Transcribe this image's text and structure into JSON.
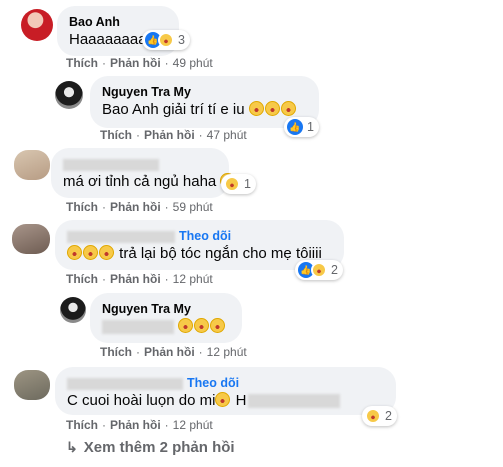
{
  "actions": {
    "like": "Thích",
    "reply": "Phản hồi",
    "sep": "·"
  },
  "comments": [
    {
      "author": "Bao Anh",
      "text": "Haaaaaaaa",
      "reactions": "3",
      "time": "49 phút"
    },
    {
      "author": "Nguyen Tra My",
      "text": "Bao Anh giải trí tí e iu",
      "reactions": "1",
      "time": "47 phút"
    },
    {
      "author": "",
      "text": "má ơi tỉnh cả ngủ haha",
      "reactions": "1",
      "time": "59 phút"
    },
    {
      "author": "",
      "follow": "Theo dõi",
      "text": "trả lại bộ tóc ngắn cho mẹ tôiiii",
      "reactions": "2",
      "time": "12 phút"
    },
    {
      "author": "Nguyen Tra My",
      "text": "",
      "time": "12 phút"
    },
    {
      "author": "",
      "follow": "Theo dõi",
      "text": "C cuoi hoài luọn do mi",
      "text_tail": "H",
      "reactions": "2",
      "time": "12 phút"
    }
  ],
  "more_replies": "Xem thêm 2 phản hồi",
  "icons": {
    "like": "like-reaction-icon",
    "haha": "haha-reaction-icon",
    "reply_arrow": "reply-arrow-icon"
  },
  "colors": {
    "link": "#1877f2",
    "muted": "#65676b",
    "bubble": "#f0f2f5"
  }
}
